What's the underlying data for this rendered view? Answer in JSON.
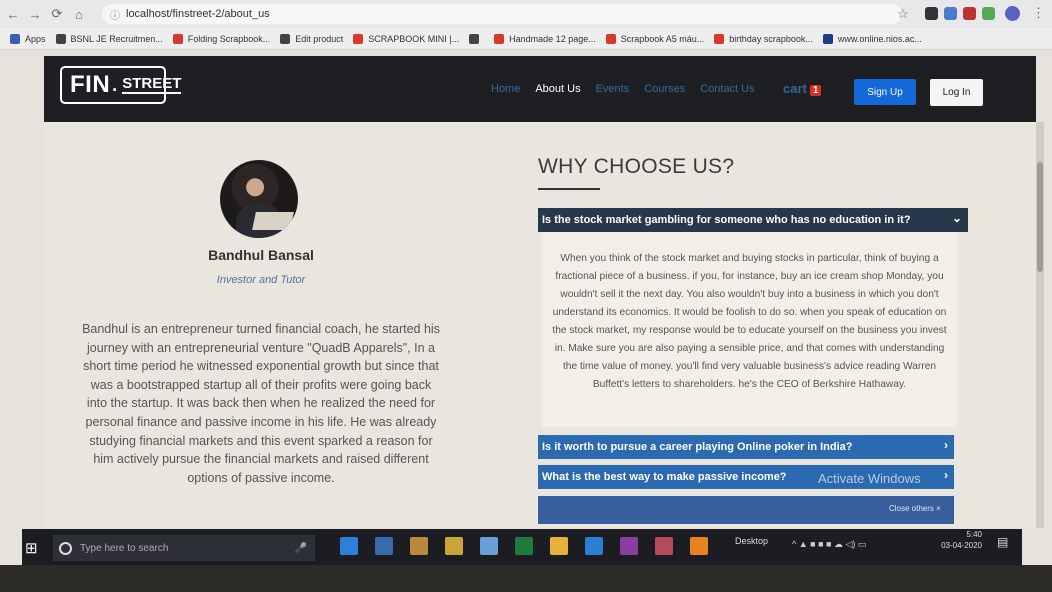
{
  "browser": {
    "url": "localhost/finstreet-2/about_us",
    "bookmarks": [
      "Apps",
      "BSNL JE Recruitmen...",
      "Folding Scrapbook...",
      "Edit product",
      "SCRAPBOOK MINI |...",
      "",
      "Handmade 12 page...",
      "Scrapbook A5 máu...",
      "birthday scrapbook...",
      "www.online.nios.ac..."
    ],
    "bookmark_colors": [
      "#3a5fb0",
      "#444444",
      "#d83a2a",
      "#444444",
      "#d83a2a",
      "#444444",
      "#d83a2a",
      "#d83a2a",
      "#d83a2a",
      "#1a3c8a"
    ]
  },
  "nav": {
    "logo_fin": "FIN",
    "logo_street": "STREET",
    "links": [
      "Home",
      "About Us",
      "Events",
      "Courses",
      "Contact Us"
    ],
    "active_link": "About Us",
    "cart_label": "cart",
    "cart_count": "1",
    "signup": "Sign Up",
    "login": "Log In"
  },
  "profile": {
    "name": "Bandhul Bansal",
    "role": "Investor and Tutor",
    "bio": "Bandhul is an entrepreneur turned financial coach, he started his journey with an entrepreneurial venture \"QuadB Apparels\", In a short time period he witnessed exponential growth but since that was a bootstrapped startup all of their profits were going back into the startup. It was back then when he realized the need for personal finance and passive income in his life. He was already studying financial markets and this event sparked a reason for him actively pursue the financial markets and raised different options of passive income."
  },
  "why": {
    "title": "WHY CHOOSE US?",
    "faqs": [
      {
        "question": "Is the stock market gambling for someone who has no education in it?",
        "answer": "When you think of the stock market and buying stocks in particular, think of buying a fractional piece of a business. if you, for instance, buy an ice cream shop Monday, you wouldn't sell it the next day. You also wouldn't buy into a business in which you don't understand its economics. It would be foolish to do so. when you speak of education on the stock market, my response would be to educate yourself on the business you invest in. Make sure you are also paying a sensible price, and that comes with understanding the time value of money. you'll find very valuable business's advice reading Warren Buffett's letters to shareholders. he's the CEO of Berkshire Hathaway."
      },
      {
        "question": "Is it worth to pursue a career playing Online poker in India?"
      },
      {
        "question": "What is the best way to make passive income?"
      }
    ],
    "close_others": "Close others ×"
  },
  "overlay": {
    "watermark": "Activate Windows"
  },
  "taskbar": {
    "search_placeholder": "Type here to search",
    "desktop": "Desktop",
    "time": "5:40",
    "date": "03-04-2020",
    "icons": [
      "edge-icon",
      "store-icon",
      "files-icon",
      "explorer-icon",
      "photos-icon",
      "excel-icon",
      "chrome-icon",
      "vscode-icon",
      "app-m-icon",
      "app-b-icon",
      "vlc-icon"
    ]
  }
}
